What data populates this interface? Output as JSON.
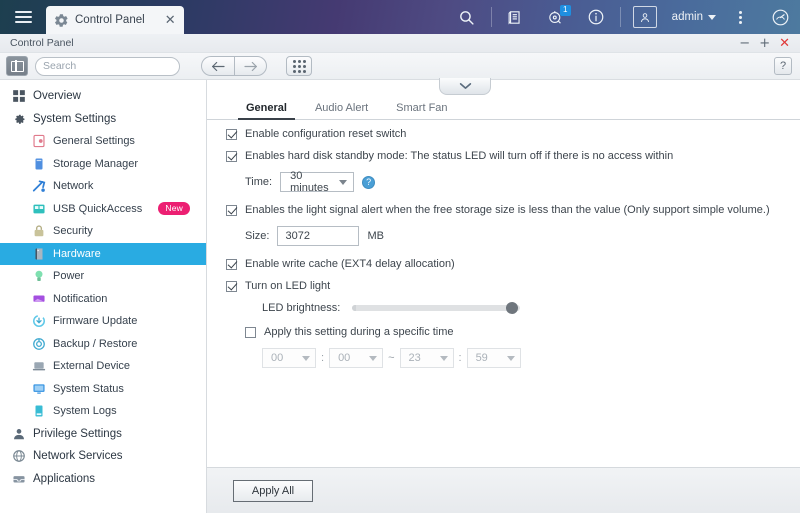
{
  "topbar": {
    "menu_icon": "hamburger-icon",
    "tab": {
      "icon": "gear-icon",
      "title": "Control Panel",
      "close": "✕"
    },
    "icons": [
      {
        "name": "search-icon",
        "label": "Search"
      },
      {
        "name": "backup-icon",
        "label": "Backup Station"
      },
      {
        "name": "notification-icon",
        "label": "Notifications",
        "badge": "1"
      },
      {
        "name": "info-icon",
        "label": "Information"
      },
      {
        "name": "user-avatar-icon",
        "label": "User"
      }
    ],
    "user": "admin",
    "more_icon": "kebab-menu-icon",
    "dashboard_icon": "dashboard-gauge-icon"
  },
  "window": {
    "title": "Control Panel",
    "minimize": "−",
    "maximize": "+",
    "close": "✕"
  },
  "toolbar": {
    "panel_toggle": "panel-toggle-icon",
    "search_placeholder": "Search",
    "search_value": "",
    "back": "←",
    "forward": "→",
    "grid": "app-grid-icon",
    "help": "?"
  },
  "sidebar": {
    "items": [
      {
        "label": "Overview",
        "level": 0,
        "icon": "overview-icon",
        "selected": false
      },
      {
        "label": "System Settings",
        "level": 0,
        "icon": "gear-icon",
        "selected": false
      },
      {
        "label": "General Settings",
        "level": 1,
        "icon": "general-settings-icon",
        "selected": false
      },
      {
        "label": "Storage Manager",
        "level": 1,
        "icon": "storage-icon",
        "selected": false
      },
      {
        "label": "Network",
        "level": 1,
        "icon": "network-icon",
        "selected": false
      },
      {
        "label": "USB QuickAccess",
        "level": 1,
        "icon": "usb-icon",
        "selected": false,
        "badge": "New"
      },
      {
        "label": "Security",
        "level": 1,
        "icon": "lock-icon",
        "selected": false
      },
      {
        "label": "Hardware",
        "level": 1,
        "icon": "hardware-icon",
        "selected": true
      },
      {
        "label": "Power",
        "level": 1,
        "icon": "power-bulb-icon",
        "selected": false
      },
      {
        "label": "Notification",
        "level": 1,
        "icon": "notification-icon",
        "selected": false
      },
      {
        "label": "Firmware Update",
        "level": 1,
        "icon": "firmware-update-icon",
        "selected": false
      },
      {
        "label": "Backup / Restore",
        "level": 1,
        "icon": "backup-restore-icon",
        "selected": false
      },
      {
        "label": "External Device",
        "level": 1,
        "icon": "external-device-icon",
        "selected": false
      },
      {
        "label": "System Status",
        "level": 1,
        "icon": "system-status-icon",
        "selected": false
      },
      {
        "label": "System Logs",
        "level": 1,
        "icon": "system-logs-icon",
        "selected": false
      },
      {
        "label": "Privilege Settings",
        "level": 0,
        "icon": "privilege-icon",
        "selected": false
      },
      {
        "label": "Network Services",
        "level": 0,
        "icon": "network-services-icon",
        "selected": false
      },
      {
        "label": "Applications",
        "level": 0,
        "icon": "applications-icon",
        "selected": false
      }
    ]
  },
  "content": {
    "collapse_icon": "chevron-down-icon",
    "tabs": [
      {
        "label": "General",
        "active": true
      },
      {
        "label": "Audio Alert",
        "active": false
      },
      {
        "label": "Smart Fan",
        "active": false
      }
    ],
    "options": {
      "reset_switch": {
        "label": "Enable configuration reset switch",
        "checked": true
      },
      "hdd_standby": {
        "label": "Enables hard disk standby mode: The status LED will turn off if there is no access within",
        "checked": true,
        "time_label": "Time:",
        "time_value": "30 minutes",
        "help": "?"
      },
      "light_signal": {
        "label": "Enables the light signal alert when the free storage size is less than the value (Only support simple volume.)",
        "checked": true,
        "size_label": "Size:",
        "size_value": "3072",
        "size_unit": "MB"
      },
      "write_cache": {
        "label": "Enable write cache (EXT4 delay allocation)",
        "checked": true
      },
      "led_light": {
        "label": "Turn on LED light",
        "checked": true,
        "brightness_label": "LED brightness:",
        "brightness_percent": 95
      },
      "specific_time": {
        "label": "Apply this setting during a specific time",
        "checked": false,
        "start_hour": "00",
        "start_min": "00",
        "range_sep": "~",
        "end_hour": "23",
        "end_min": "59",
        "colon": ":"
      }
    }
  },
  "footer": {
    "apply_label": "Apply All"
  },
  "colors": {
    "accent_selected": "#29abe2",
    "badge_new": "#ec1f72",
    "close_red": "#e03a3a",
    "notify_badge": "#1f8fe0"
  }
}
